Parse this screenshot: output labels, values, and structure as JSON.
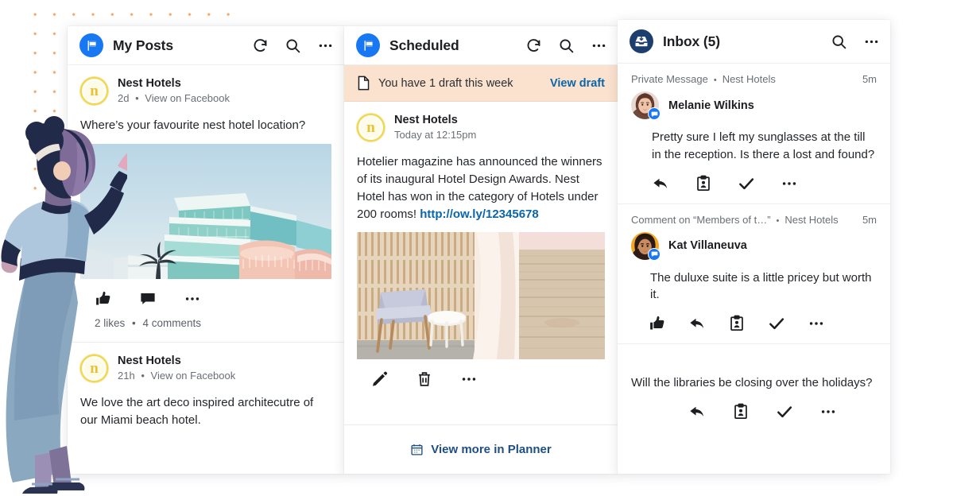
{
  "columns": {
    "posts": {
      "title": "My Posts",
      "icon": "flag-icon",
      "header_icons": [
        "refresh-icon",
        "search-icon",
        "more-icon"
      ],
      "items": [
        {
          "author": "Nest Hotels",
          "avatar_letter": "n",
          "time": "2d",
          "source": "View on Facebook",
          "text": "Where’s your favourite nest hotel location?",
          "has_photo": true,
          "photo": "art-deco-hotel-photo",
          "actions": [
            "like-icon",
            "comment-icon",
            "more-icon"
          ],
          "likes": "2 likes",
          "comments": "4 comments"
        },
        {
          "author": "Nest Hotels",
          "avatar_letter": "n",
          "time": "21h",
          "source": "View on Facebook",
          "text": "We love the art deco inspired architecutre of our Miami beach hotel.",
          "has_photo": false
        }
      ]
    },
    "scheduled": {
      "title": "Scheduled",
      "icon": "flag-icon",
      "header_icons": [
        "refresh-icon",
        "search-icon",
        "more-icon"
      ],
      "draft_banner": {
        "icon": "document-icon",
        "text": "You have 1 draft this week",
        "link": "View draft"
      },
      "post": {
        "author": "Nest Hotels",
        "avatar_letter": "n",
        "time": "Today at 12:15pm",
        "text_before_link": "Hotelier magazine has announced the winners of its inaugural Hotel Design Awards. Nest Hotel has won in the category of Hotels under 200 rooms! ",
        "link": "http://ow.ly/12345678",
        "photo": "hotel-interior-photo",
        "actions": [
          "edit-icon",
          "delete-icon",
          "more-icon"
        ]
      },
      "planner": {
        "icon": "calendar-icon",
        "label": "View more in Planner"
      }
    },
    "inbox": {
      "title": "Inbox (5)",
      "icon": "inbox-icon",
      "header_icons": [
        "search-icon",
        "more-icon"
      ],
      "items": [
        {
          "type": "Private Message",
          "account": "Nest Hotels",
          "time": "5m",
          "name": "Melanie Wilkins",
          "text": "Pretty sure I left my sunglasses at the till in the reception. Is there a lost and found?",
          "actions": [
            "reply-icon",
            "assign-icon",
            "check-icon",
            "more-icon"
          ]
        },
        {
          "type": "Comment on “Members of t…”",
          "account": "Nest Hotels",
          "time": "5m",
          "name": "Kat Villaneuva",
          "text": "The duluxe suite is a little pricey but worth it.",
          "actions": [
            "like-icon",
            "reply-icon",
            "assign-icon",
            "check-icon",
            "more-icon"
          ]
        },
        {
          "type": "",
          "account": "",
          "time": "",
          "name": "",
          "text": "Will the libraries be closing over the holidays?",
          "actions": [
            "reply-icon",
            "assign-icon",
            "check-icon",
            "more-icon"
          ]
        }
      ]
    }
  },
  "decoration": {
    "dot_grid_color": "#f2a76a",
    "illustration": "woman-reaching-illustration"
  },
  "colors": {
    "brand_blue": "#1877f2",
    "inbox_navy": "#1c3f6e",
    "link_blue": "#0a66a8",
    "draft_banner_bg": "#fbe2cf",
    "avatar_gold": "#f4d744"
  }
}
